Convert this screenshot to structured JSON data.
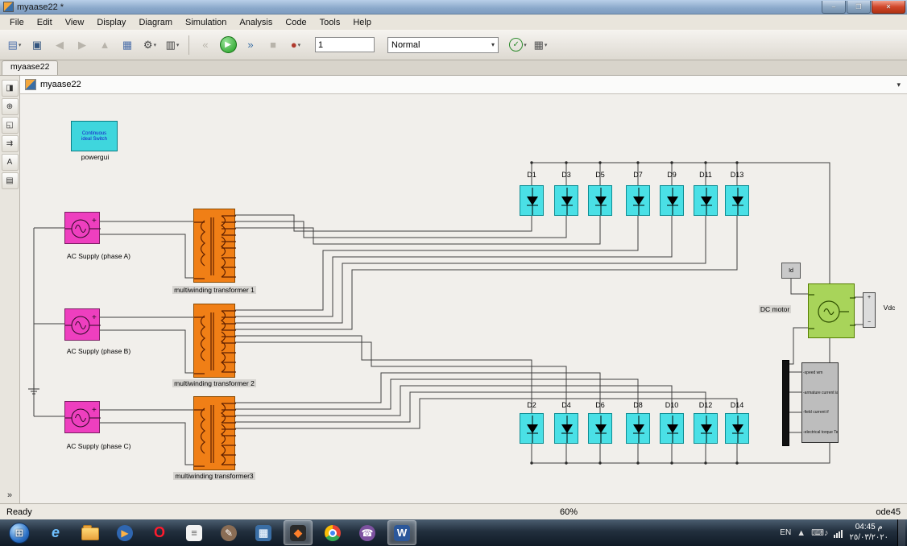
{
  "window": {
    "title": "myaase22 *",
    "controls": {
      "minimize": "–",
      "maximize": "❐",
      "close": "✕"
    }
  },
  "menu": [
    "File",
    "Edit",
    "View",
    "Display",
    "Diagram",
    "Simulation",
    "Analysis",
    "Code",
    "Tools",
    "Help"
  ],
  "toolbar": {
    "stop_time": "1",
    "sim_mode": "Normal",
    "buttons_a": [
      {
        "name": "new-model-button",
        "glyph": "▤",
        "color": "#4a6ea9",
        "dd": true
      },
      {
        "name": "save-button",
        "glyph": "▣",
        "color": "#33557f"
      },
      {
        "name": "back-button",
        "glyph": "◀",
        "disabled": true
      },
      {
        "name": "forward-button",
        "glyph": "▶",
        "disabled": true
      },
      {
        "name": "up-to-parent-button",
        "glyph": "▲",
        "disabled": true
      },
      {
        "name": "library-browser-button",
        "glyph": "▦",
        "color": "#4a6ea9"
      },
      {
        "name": "configure-button",
        "glyph": "⚙",
        "dd": true
      },
      {
        "name": "model-configuration-button",
        "glyph": "▥",
        "dd": true
      }
    ],
    "buttons_b": [
      {
        "name": "step-back-button",
        "glyph": "«",
        "disabled": true
      },
      {
        "name": "run-button",
        "glyph": "▶",
        "shape": "run"
      },
      {
        "name": "step-forward-button",
        "glyph": "»",
        "color": "#3a6ea5"
      },
      {
        "name": "stop-button",
        "glyph": "■",
        "disabled": true
      },
      {
        "name": "highlight-button",
        "glyph": "●",
        "color": "#b03a2e",
        "dd": true
      }
    ],
    "buttons_c": [
      {
        "name": "update-diagram-button",
        "glyph": "✓",
        "shape": "check",
        "dd": true
      },
      {
        "name": "build-button",
        "glyph": "▦",
        "color": "#555555",
        "dd": true
      }
    ]
  },
  "sidebar": {
    "icons": [
      {
        "name": "show-model-browser-icon",
        "glyph": "◨"
      },
      {
        "name": "zoom-icon",
        "glyph": "⊕"
      },
      {
        "name": "fit-to-view-icon",
        "glyph": "◱"
      },
      {
        "name": "signal-routing-icon",
        "glyph": "⇉"
      },
      {
        "name": "annotation-icon",
        "glyph": "A"
      },
      {
        "name": "screenshot-icon",
        "glyph": "▤"
      }
    ],
    "more": "»"
  },
  "tab": "myaase22",
  "breadcrumb": "myaase22",
  "canvas": {
    "powergui": {
      "line1": "Continuous",
      "line2": "ideal Switch",
      "caption": "powergui"
    },
    "sources": [
      "AC Supply (phase A)",
      "AC Supply (phase B)",
      "AC Supply (phase C)"
    ],
    "transformers": [
      "multiwinding transformer 1",
      "multiwinding transformer 2",
      "multiwinding transformer3"
    ],
    "diodes_top": [
      "D1",
      "D3",
      "D5",
      "D7",
      "D9",
      "D11",
      "D13"
    ],
    "diodes_bottom": [
      "D2",
      "D4",
      "D6",
      "D8",
      "D10",
      "D12",
      "D14"
    ],
    "motor_label": "DC motor",
    "id_label": "Id",
    "vdc_label": "Vdc",
    "vdc_ports": {
      "plus": "+",
      "minus": "−"
    },
    "scope_signals": [
      "speed wm",
      "armature current ia",
      "field current if",
      "electrical torque Te"
    ]
  },
  "status": {
    "ready": "Ready",
    "zoom": "60%",
    "solver": "ode45"
  },
  "taskbar": {
    "apps": [
      {
        "name": "start",
        "shape": "orb",
        "glyph": "⊞"
      },
      {
        "name": "internet-explorer",
        "shape": "letter",
        "glyph": "e",
        "fg": "#6fc0ff"
      },
      {
        "name": "file-explorer",
        "shape": "folder"
      },
      {
        "name": "media-player",
        "shape": "circle",
        "glyph": "▶",
        "fg": "#ffb347",
        "bg": "#2f66b0"
      },
      {
        "name": "opera",
        "shape": "letter",
        "glyph": "O",
        "fg": "#ff1b2d"
      },
      {
        "name": "text-editor",
        "shape": "tile",
        "glyph": "≡",
        "fg": "#666666",
        "bg": "#f2f2f2"
      },
      {
        "name": "gimp",
        "shape": "circle",
        "glyph": "✎",
        "fg": "#ffffff",
        "bg": "#8a6d55"
      },
      {
        "name": "calculator",
        "shape": "tile",
        "glyph": "▦",
        "fg": "#dce9f7",
        "bg": "#3a6ea5"
      },
      {
        "name": "matlab",
        "shape": "tile",
        "glyph": "◆",
        "fg": "#ff7f2a",
        "bg": "#2a2a2a",
        "active": true
      },
      {
        "name": "chrome",
        "shape": "chrome"
      },
      {
        "name": "viber",
        "shape": "circle",
        "glyph": "☎",
        "fg": "#ffffff",
        "bg": "#7d52a0"
      },
      {
        "name": "word",
        "shape": "tile",
        "glyph": "W",
        "fg": "#ffffff",
        "bg": "#2b579a",
        "active": true
      }
    ],
    "tray": {
      "lang": "EN",
      "hidden_icons": "▲",
      "icons": [
        {
          "name": "keyboard-icon",
          "glyph": "⌨"
        },
        {
          "name": "volume-icon",
          "glyph": "♪"
        }
      ],
      "time": "04:45 م",
      "date": "٢٥/٠٣/٢٠٢٠"
    }
  }
}
